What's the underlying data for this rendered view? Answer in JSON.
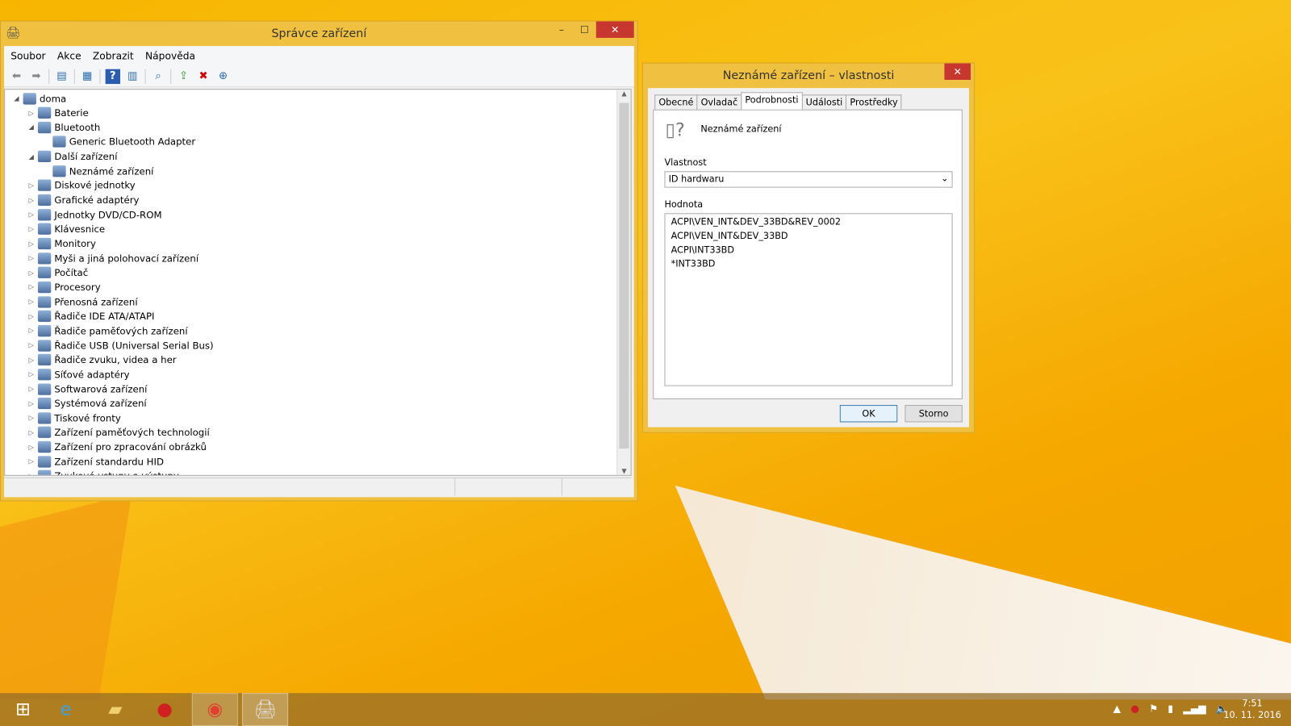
{
  "devmgr": {
    "title": "Správce zařízení",
    "menu": [
      "Soubor",
      "Akce",
      "Zobrazit",
      "Nápověda"
    ],
    "tree": [
      {
        "label": "doma",
        "level": 0,
        "exp": "expanded",
        "icon": "computer-icon"
      },
      {
        "label": "Baterie",
        "level": 1,
        "exp": "collapsed",
        "icon": "battery-icon"
      },
      {
        "label": "Bluetooth",
        "level": 1,
        "exp": "expanded",
        "icon": "bluetooth-icon"
      },
      {
        "label": "Generic Bluetooth Adapter",
        "level": 2,
        "exp": "",
        "icon": "bluetooth-warning-icon"
      },
      {
        "label": "Další zařízení",
        "level": 1,
        "exp": "expanded",
        "icon": "unknown-device-icon"
      },
      {
        "label": "Neznámé zařízení",
        "level": 2,
        "exp": "",
        "icon": "unknown-device-warning-icon"
      },
      {
        "label": "Diskové jednotky",
        "level": 1,
        "exp": "collapsed",
        "icon": "disk-icon"
      },
      {
        "label": "Grafické adaptéry",
        "level": 1,
        "exp": "collapsed",
        "icon": "display-adapter-icon"
      },
      {
        "label": "Jednotky DVD/CD-ROM",
        "level": 1,
        "exp": "collapsed",
        "icon": "dvd-icon"
      },
      {
        "label": "Klávesnice",
        "level": 1,
        "exp": "collapsed",
        "icon": "keyboard-icon"
      },
      {
        "label": "Monitory",
        "level": 1,
        "exp": "collapsed",
        "icon": "monitor-icon"
      },
      {
        "label": "Myši a jiná polohovací zařízení",
        "level": 1,
        "exp": "collapsed",
        "icon": "mouse-icon"
      },
      {
        "label": "Počítač",
        "level": 1,
        "exp": "collapsed",
        "icon": "computer-icon"
      },
      {
        "label": "Procesory",
        "level": 1,
        "exp": "collapsed",
        "icon": "processor-icon"
      },
      {
        "label": "Přenosná zařízení",
        "level": 1,
        "exp": "collapsed",
        "icon": "portable-device-icon"
      },
      {
        "label": "Řadiče IDE ATA/ATAPI",
        "level": 1,
        "exp": "collapsed",
        "icon": "ide-icon"
      },
      {
        "label": "Řadiče paměťových zařízení",
        "level": 1,
        "exp": "collapsed",
        "icon": "storage-controller-icon"
      },
      {
        "label": "Řadiče USB (Universal Serial Bus)",
        "level": 1,
        "exp": "collapsed",
        "icon": "usb-icon"
      },
      {
        "label": "Řadiče zvuku, videa a her",
        "level": 1,
        "exp": "collapsed",
        "icon": "sound-icon"
      },
      {
        "label": "Síťové adaptéry",
        "level": 1,
        "exp": "collapsed",
        "icon": "network-icon"
      },
      {
        "label": "Softwarová zařízení",
        "level": 1,
        "exp": "collapsed",
        "icon": "software-device-icon"
      },
      {
        "label": "Systémová zařízení",
        "level": 1,
        "exp": "collapsed",
        "icon": "system-device-icon"
      },
      {
        "label": "Tiskové fronty",
        "level": 1,
        "exp": "collapsed",
        "icon": "printer-icon"
      },
      {
        "label": "Zařízení paměťových technologií",
        "level": 1,
        "exp": "collapsed",
        "icon": "memory-tech-icon"
      },
      {
        "label": "Zařízení pro zpracování obrázků",
        "level": 1,
        "exp": "collapsed",
        "icon": "imaging-icon"
      },
      {
        "label": "Zařízení standardu HID",
        "level": 1,
        "exp": "collapsed",
        "icon": "hid-icon"
      },
      {
        "label": "Zvukové vstupy a výstupy",
        "level": 1,
        "exp": "collapsed",
        "icon": "audio-io-icon"
      }
    ]
  },
  "dialog": {
    "title": "Neznámé zařízení – vlastnosti",
    "tabs": [
      "Obecné",
      "Ovladač",
      "Podrobnosti",
      "Události",
      "Prostředky"
    ],
    "active_tab": 2,
    "device_name": "Neznámé zařízení",
    "property_label": "Vlastnost",
    "property_value": "ID hardwaru",
    "value_label": "Hodnota",
    "values": [
      "ACPI\\VEN_INT&DEV_33BD&REV_0002",
      "ACPI\\VEN_INT&DEV_33BD",
      "ACPI\\INT33BD",
      "*INT33BD"
    ],
    "ok": "OK",
    "cancel": "Storno"
  },
  "taskbar": {
    "time": "7:51",
    "date": "10. 11. 2016",
    "apps": [
      "start-icon",
      "internet-explorer-icon",
      "file-explorer-icon",
      "app-red-icon",
      "chrome-icon",
      "device-manager-icon"
    ]
  }
}
